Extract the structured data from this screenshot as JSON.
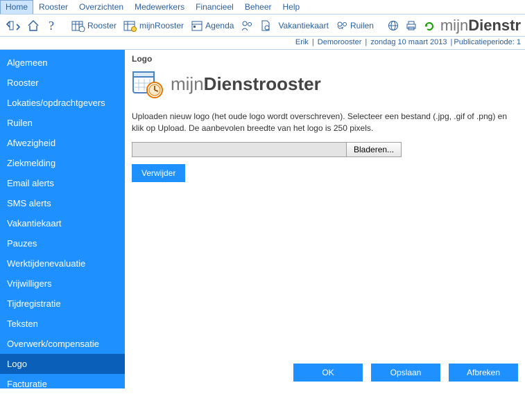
{
  "menubar": {
    "items": [
      "Home",
      "Rooster",
      "Overzichten",
      "Medewerkers",
      "Financieel",
      "Beheer",
      "Help"
    ],
    "active_index": 0
  },
  "toolbar": {
    "rooster": "Rooster",
    "mijnrooster": "mijnRooster",
    "agenda": "Agenda",
    "vakantiekaart": "Vakantiekaart",
    "ruilen": "Ruilen"
  },
  "brand": {
    "thin": "mijn",
    "bold": "Dienstr"
  },
  "statusbar": {
    "user": "Erik",
    "rooster": "Demorooster",
    "date": "zondag 10 maart 2013",
    "pub": "Publicatieperiode: 1"
  },
  "sidebar": {
    "items": [
      "Algemeen",
      "Rooster",
      "Lokaties/opdrachtgevers",
      "Ruilen",
      "Afwezigheid",
      "Ziekmelding",
      "Email alerts",
      "SMS alerts",
      "Vakantiekaart",
      "Pauzes",
      "Werktijdenevaluatie",
      "Vrijwilligers",
      "Tijdregistratie",
      "Teksten",
      "Overwerk/compensatie",
      "Logo",
      "Facturatie"
    ],
    "selected_index": 15
  },
  "content": {
    "heading": "Logo",
    "logo_thin": "mijn",
    "logo_bold": "Dienstrooster",
    "description": "Uploaden nieuw logo (het oude logo wordt overschreven). Selecteer een bestand (.jpg, .gif of .png) en klik op Upload. De aanbevolen breedte van het logo is 250 pixels.",
    "browse": "Bladeren...",
    "verwijder": "Verwijder",
    "ok": "OK",
    "opslaan": "Opslaan",
    "afbreken": "Afbreken"
  }
}
